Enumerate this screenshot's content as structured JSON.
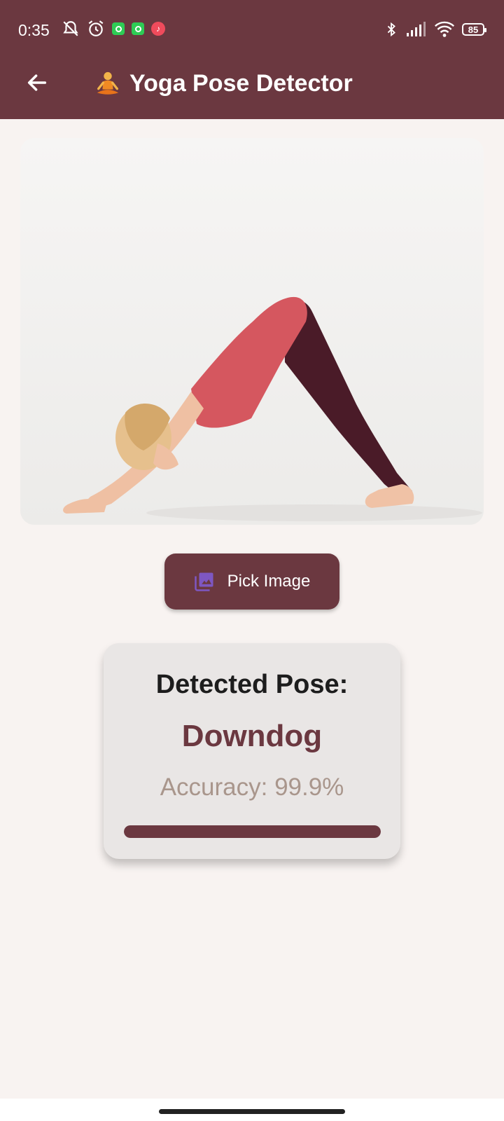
{
  "status_bar": {
    "time": "0:35",
    "battery": "85",
    "icons": [
      "mute-icon",
      "alarm-icon",
      "whatsapp-icon",
      "whatsapp-icon",
      "music-icon",
      "bluetooth-icon",
      "signal-icon",
      "wifi-icon",
      "battery-icon"
    ]
  },
  "app_bar": {
    "title": "Yoga Pose Detector",
    "title_emoji": "person-in-lotus-position-icon",
    "back_icon": "arrow-back-icon",
    "background": "#6b3840"
  },
  "image_preview": {
    "subject": "woman-downward-dog-photo"
  },
  "pick_button": {
    "label": "Pick Image",
    "icon": "photo-library-icon",
    "icon_color": "#7e57c2"
  },
  "result": {
    "heading": "Detected Pose:",
    "pose": "Downdog",
    "accuracy_text": "Accuracy: 99.9%",
    "accuracy_value": 0.999,
    "accent_color": "#6b3840",
    "muted_color": "#a9968c"
  }
}
